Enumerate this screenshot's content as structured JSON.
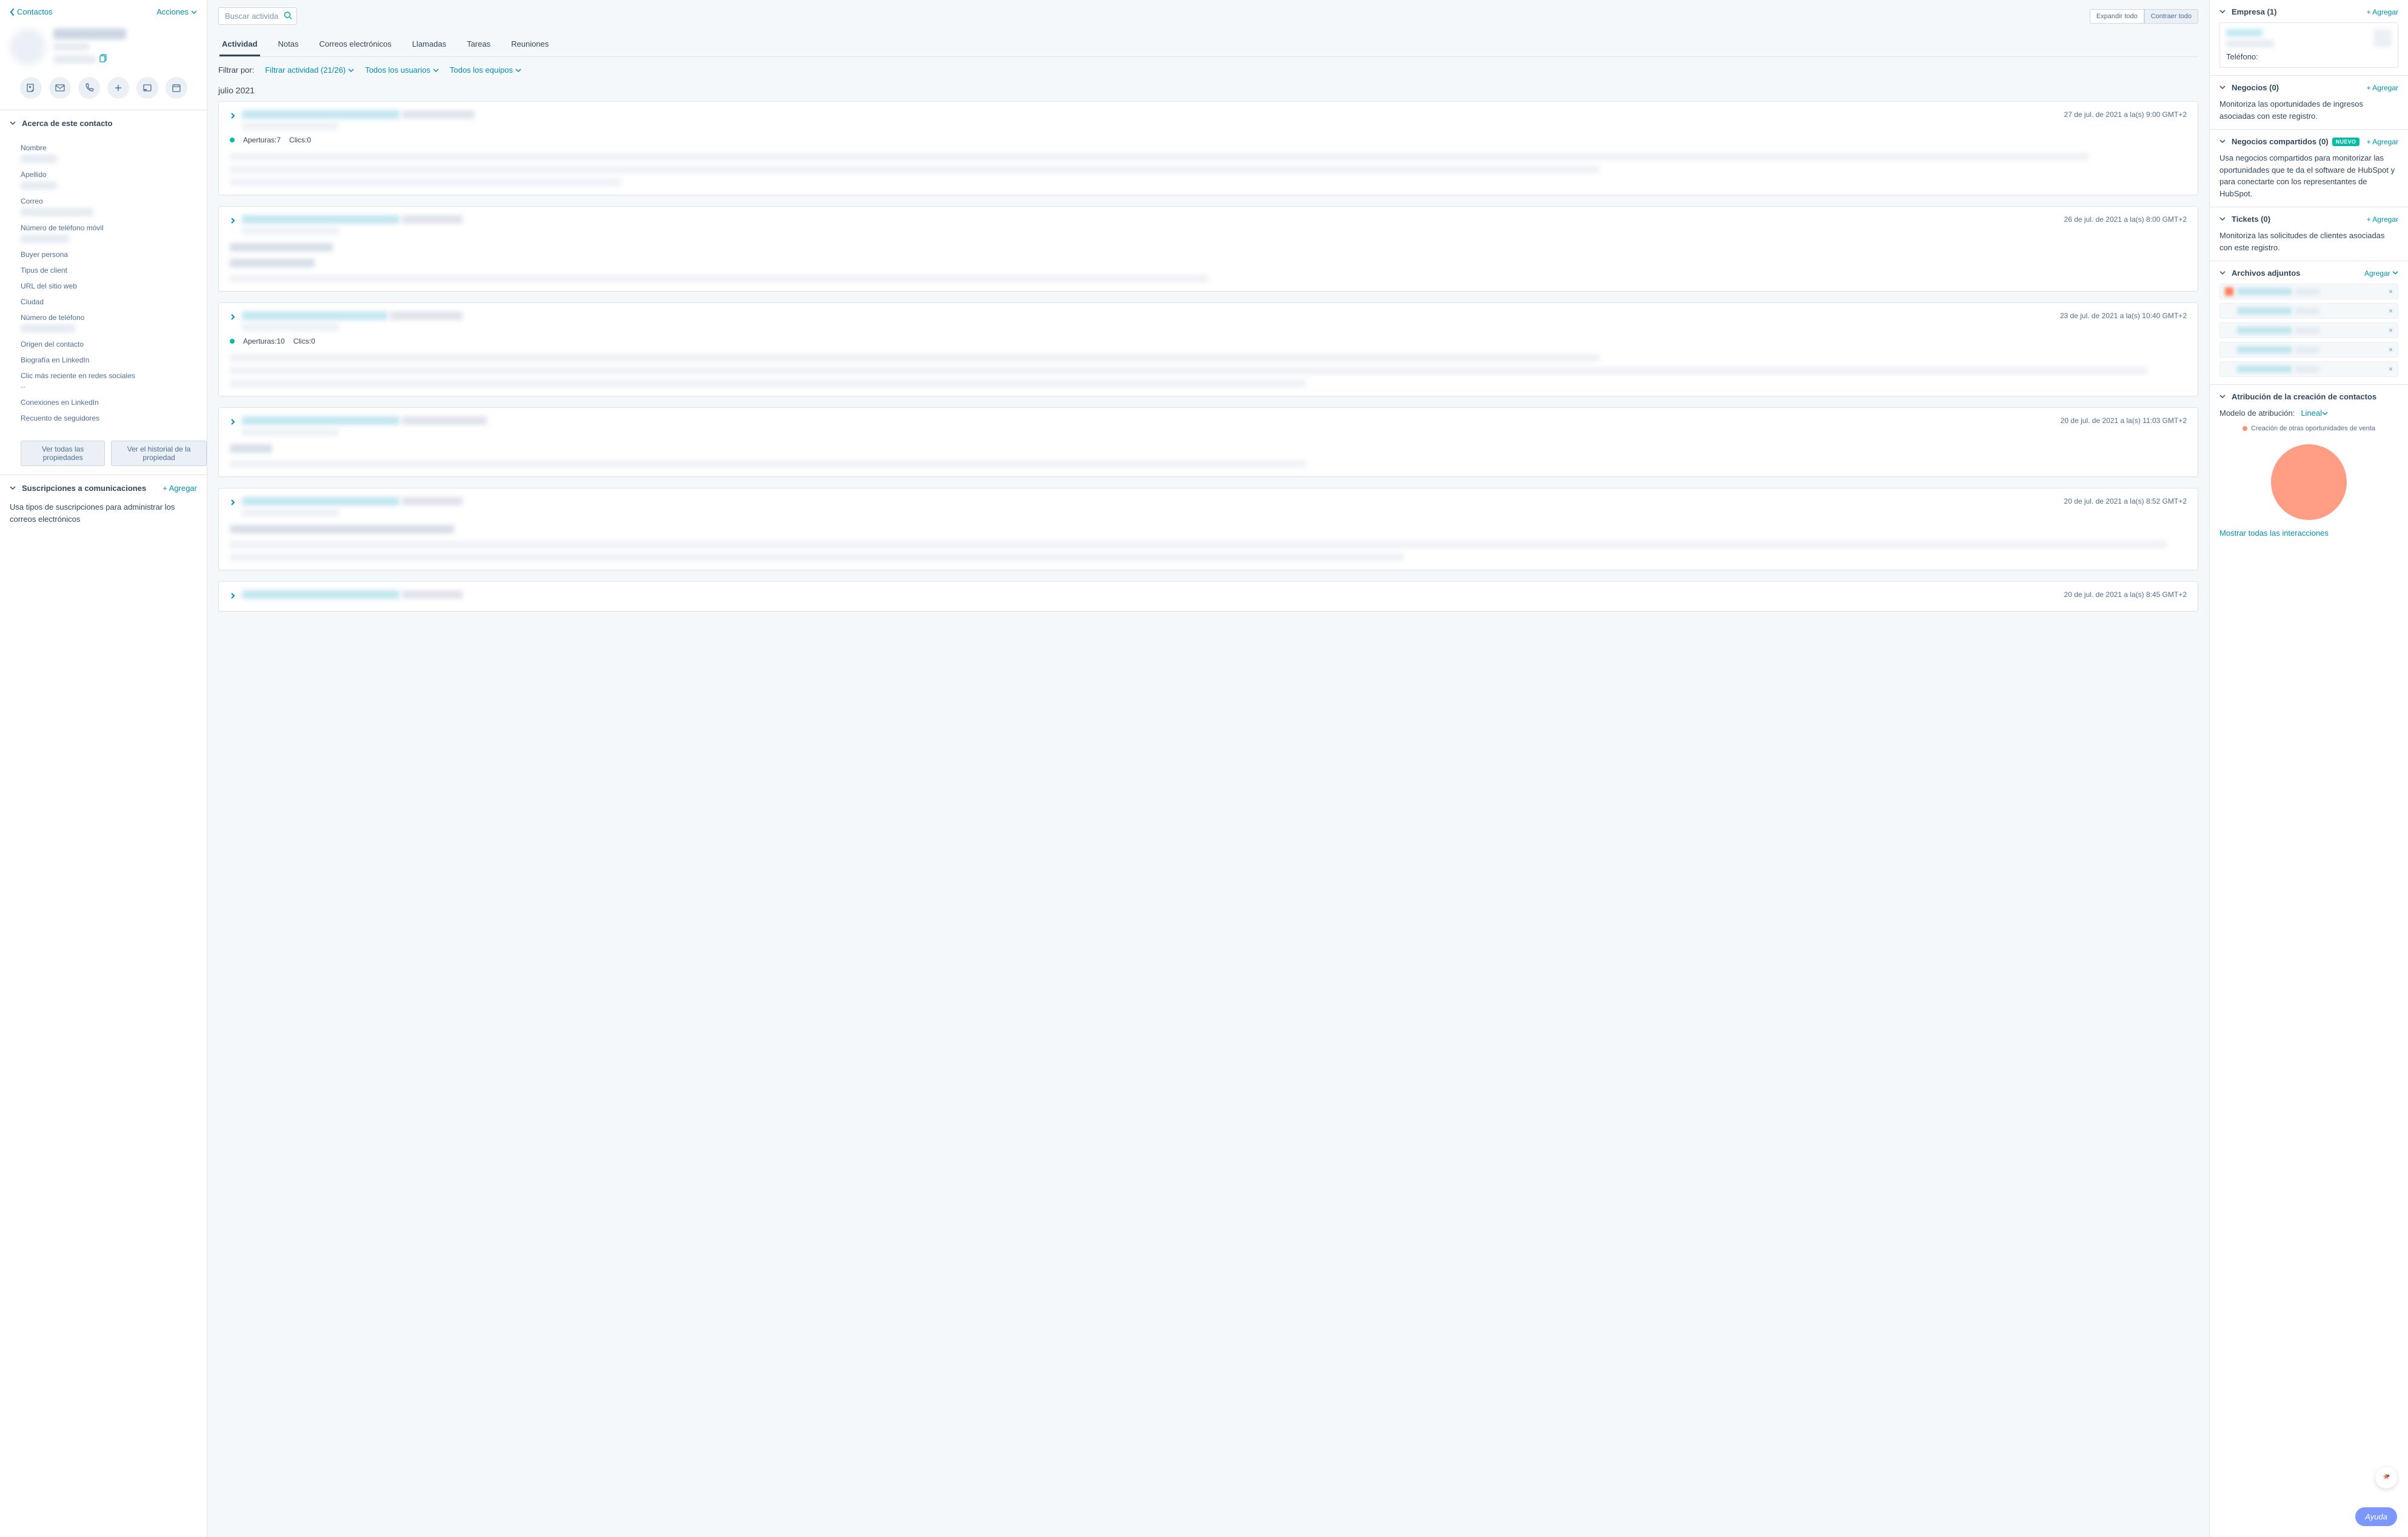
{
  "left": {
    "back_label": "Contactos",
    "actions_label": "Acciones",
    "about_section": "Acerca de este contacto",
    "props": {
      "name_label": "Nombre",
      "surname_label": "Apellido",
      "email_label": "Correo",
      "mobile_label": "Número de teléfono móvil",
      "buyer_label": "Buyer persona",
      "client_type_label": "Tipus de client",
      "website_label": "URL del sitio web",
      "city_label": "Ciudad",
      "phone_label": "Número de teléfono",
      "origin_label": "Origen del contacto",
      "linkedin_bio_label": "Biografía en LinkedIn",
      "social_click_label": "Clic más reciente en redes sociales",
      "social_click_value": "--",
      "linkedin_conn_label": "Conexiones en LinkedIn",
      "followers_label": "Recuento de seguidores"
    },
    "view_all_props": "Ver todas las propiedades",
    "view_history": "Ver el historial de la propiedad",
    "subs_section": "Suscripciones a comunicaciones",
    "subs_add": "+ Agregar",
    "subs_desc": "Usa tipos de suscripciones para administrar los correos electrónicos"
  },
  "middle": {
    "search_placeholder": "Buscar actividad",
    "expand_all": "Expandir todo",
    "collapse_all": "Contraer todo",
    "tabs": {
      "activity": "Actividad",
      "notes": "Notas",
      "emails": "Correos electrónicos",
      "calls": "Llamadas",
      "tasks": "Tareas",
      "meetings": "Reuniones"
    },
    "filter_label": "Filtrar por:",
    "filter_activity": "Filtrar actividad (21/26)",
    "filter_users": "Todos los usuarios",
    "filter_teams": "Todos los equipos",
    "month": "julio 2021",
    "cards": [
      {
        "ts": "27 de jul. de 2021 a la(s) 9:00 GMT+2",
        "opens_label": "Aperturas:",
        "opens_value": "7",
        "clicks_label": "Clics:",
        "clicks_value": "0"
      },
      {
        "ts": "26 de jul. de 2021 a la(s) 8:00 GMT+2"
      },
      {
        "ts": "23 de jul. de 2021 a la(s) 10:40 GMT+2",
        "opens_label": "Aperturas:",
        "opens_value": "10",
        "clicks_label": "Clics:",
        "clicks_value": "0"
      },
      {
        "ts": "20 de jul. de 2021 a la(s) 11:03 GMT+2"
      },
      {
        "ts": "20 de jul. de 2021 a la(s) 8:52 GMT+2"
      },
      {
        "ts": "20 de jul. de 2021 a la(s) 8:45 GMT+2"
      }
    ]
  },
  "right": {
    "company": {
      "title": "Empresa (1)",
      "add": "+ Agregar",
      "tel_label": "Teléfono:"
    },
    "deals": {
      "title": "Negocios (0)",
      "add": "+ Agregar",
      "desc": "Monitoriza las oportunidades de ingresos asociadas con este registro."
    },
    "shared_deals": {
      "title": "Negocios compartidos (0)",
      "badge": "NUEVO",
      "add": "+ Agregar",
      "desc": "Usa negocios compartidos para monitorizar las oportunidades que te da el software de HubSpot y para conectarte con los representantes de HubSpot."
    },
    "tickets": {
      "title": "Tickets (0)",
      "add": "+ Agregar",
      "desc": "Monitoriza las solicitudes de clientes asociadas con este registro."
    },
    "attachments": {
      "title": "Archivos adjuntos",
      "add": "Agregar",
      "items": [
        1,
        2,
        3,
        4,
        5
      ]
    },
    "attribution": {
      "title": "Atribución de la creación de contactos",
      "model_label": "Modelo de atribución:",
      "model_value": "Lineal",
      "legend": "Creación de otras oportunidades de venta",
      "show_all": "Mostrar todas las interacciones"
    }
  },
  "help": "Ayuda"
}
